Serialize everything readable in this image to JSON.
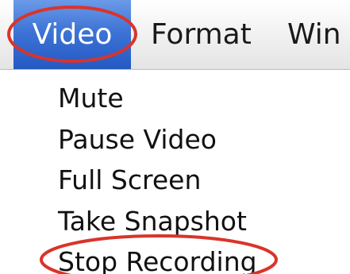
{
  "menubar": {
    "menus": [
      {
        "label": "Video",
        "selected": true
      },
      {
        "label": "Format"
      },
      {
        "label": "Win"
      }
    ]
  },
  "video_menu": {
    "items": [
      {
        "label": "Mute"
      },
      {
        "label": "Pause Video"
      },
      {
        "label": "Full Screen"
      },
      {
        "label": "Take Snapshot"
      },
      {
        "label": "Stop Recording"
      }
    ]
  },
  "colors": {
    "selection_blue": "#3d74d6",
    "annotation_red": "#d9342b"
  }
}
